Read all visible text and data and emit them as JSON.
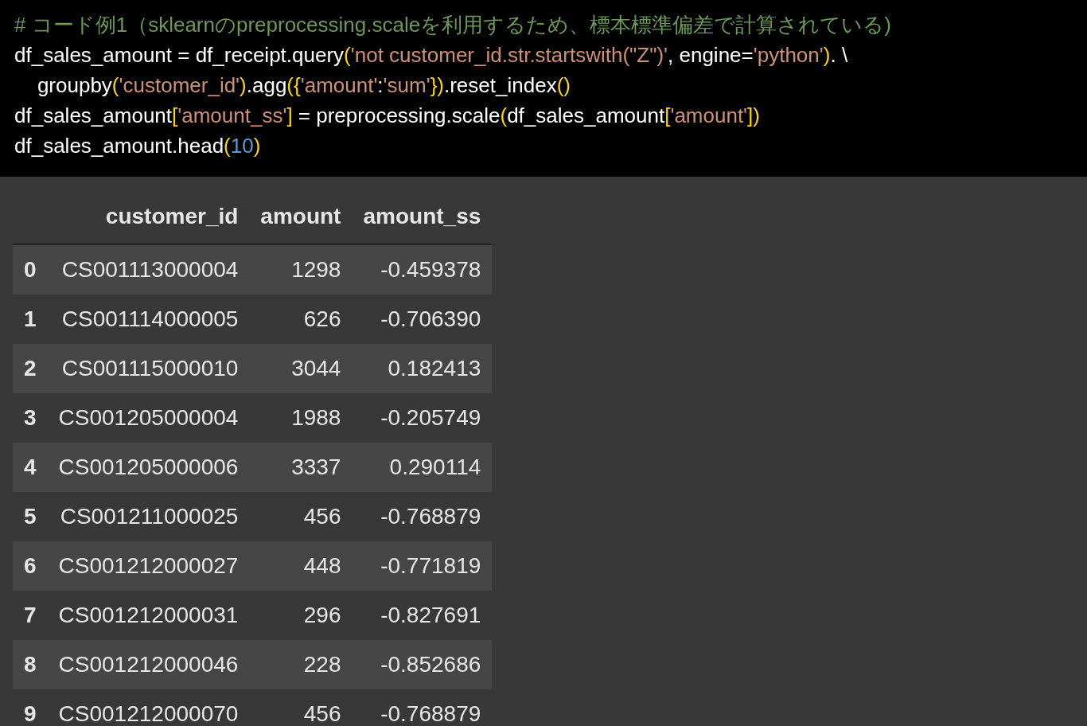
{
  "code_cell": {
    "lines": [
      {
        "tokens": [
          {
            "kind": "comment",
            "text": "# コード例1（sklearnのpreprocessing.scaleを利用するため、標本標準偏差で計算されている)"
          }
        ]
      },
      {
        "tokens": [
          {
            "kind": "plain",
            "text": "df_sales_amount = df_receipt.query"
          },
          {
            "kind": "bracket",
            "text": "("
          },
          {
            "kind": "string",
            "text": "'not customer_id.str.startswith(\"Z\")'"
          },
          {
            "kind": "plain",
            "text": ", engine="
          },
          {
            "kind": "string",
            "text": "'python'"
          },
          {
            "kind": "bracket",
            "text": ")"
          },
          {
            "kind": "plain",
            "text": ". \\"
          }
        ]
      },
      {
        "tokens": [
          {
            "kind": "plain",
            "text": "    groupby"
          },
          {
            "kind": "bracket",
            "text": "("
          },
          {
            "kind": "string",
            "text": "'customer_id'"
          },
          {
            "kind": "bracket",
            "text": ")"
          },
          {
            "kind": "plain",
            "text": ".agg"
          },
          {
            "kind": "bracket",
            "text": "({"
          },
          {
            "kind": "string",
            "text": "'amount'"
          },
          {
            "kind": "plain",
            "text": ":"
          },
          {
            "kind": "string",
            "text": "'sum'"
          },
          {
            "kind": "bracket",
            "text": "})"
          },
          {
            "kind": "plain",
            "text": ".reset_index"
          },
          {
            "kind": "bracket",
            "text": "()"
          }
        ]
      },
      {
        "tokens": [
          {
            "kind": "plain",
            "text": "df_sales_amount"
          },
          {
            "kind": "bracket",
            "text": "["
          },
          {
            "kind": "string",
            "text": "'amount_ss'"
          },
          {
            "kind": "bracket",
            "text": "]"
          },
          {
            "kind": "plain",
            "text": " = preprocessing.scale"
          },
          {
            "kind": "bracket",
            "text": "("
          },
          {
            "kind": "plain",
            "text": "df_sales_amount"
          },
          {
            "kind": "bracket",
            "text": "["
          },
          {
            "kind": "string",
            "text": "'amount'"
          },
          {
            "kind": "bracket",
            "text": "])"
          }
        ]
      },
      {
        "tokens": [
          {
            "kind": "plain",
            "text": "df_sales_amount.head"
          },
          {
            "kind": "bracket",
            "text": "("
          },
          {
            "kind": "number",
            "text": "10"
          },
          {
            "kind": "bracket",
            "text": ")"
          }
        ]
      }
    ]
  },
  "output_table": {
    "columns": [
      "customer_id",
      "amount",
      "amount_ss"
    ],
    "rows": [
      {
        "index": "0",
        "cells": [
          "CS001113000004",
          "1298",
          "-0.459378"
        ]
      },
      {
        "index": "1",
        "cells": [
          "CS001114000005",
          "626",
          "-0.706390"
        ]
      },
      {
        "index": "2",
        "cells": [
          "CS001115000010",
          "3044",
          "0.182413"
        ]
      },
      {
        "index": "3",
        "cells": [
          "CS001205000004",
          "1988",
          "-0.205749"
        ]
      },
      {
        "index": "4",
        "cells": [
          "CS001205000006",
          "3337",
          "0.290114"
        ]
      },
      {
        "index": "5",
        "cells": [
          "CS001211000025",
          "456",
          "-0.768879"
        ]
      },
      {
        "index": "6",
        "cells": [
          "CS001212000027",
          "448",
          "-0.771819"
        ]
      },
      {
        "index": "7",
        "cells": [
          "CS001212000031",
          "296",
          "-0.827691"
        ]
      },
      {
        "index": "8",
        "cells": [
          "CS001212000046",
          "228",
          "-0.852686"
        ]
      },
      {
        "index": "9",
        "cells": [
          "CS001212000070",
          "456",
          "-0.768879"
        ]
      }
    ]
  }
}
